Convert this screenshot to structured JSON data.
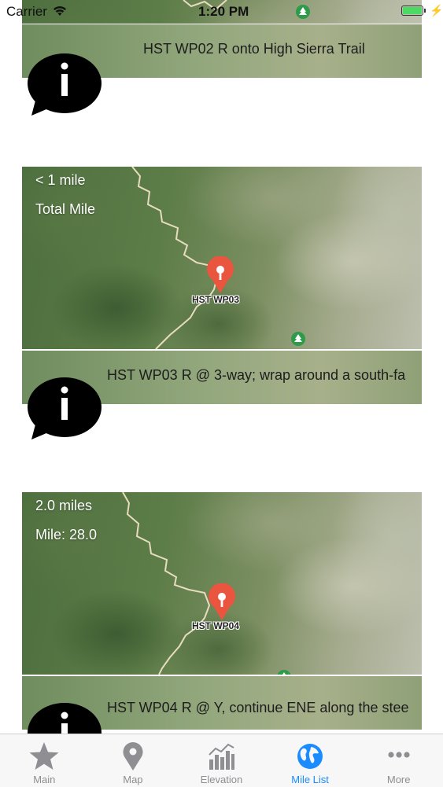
{
  "status_bar": {
    "carrier": "Carrier",
    "time": "1:20 PM",
    "battery_color": "#4cd964"
  },
  "waypoints": [
    {
      "description": "HST WP02 R onto High Sierra Trail"
    },
    {
      "distance": "< 1 mile",
      "total": "Total Mile",
      "pin_label": "HST WP03",
      "description": "HST WP03 R @ 3-way; wrap around a south-fa"
    },
    {
      "distance": "2.0 miles",
      "total": "Mile: 28.0",
      "pin_label": "HST WP04",
      "description": "HST WP04 R @ Y, continue ENE along the stee"
    }
  ],
  "tabs": [
    {
      "label": "Main",
      "icon": "star-icon"
    },
    {
      "label": "Map",
      "icon": "location-pin-icon"
    },
    {
      "label": "Elevation",
      "icon": "bar-chart-icon"
    },
    {
      "label": "Mile List",
      "icon": "globe-icon",
      "active": true
    },
    {
      "label": "More",
      "icon": "more-dots-icon"
    }
  ],
  "colors": {
    "accent": "#1a8cff",
    "tab_inactive": "#8e8e93",
    "pin": "#e9553f",
    "trail": "#e8dcc0"
  }
}
